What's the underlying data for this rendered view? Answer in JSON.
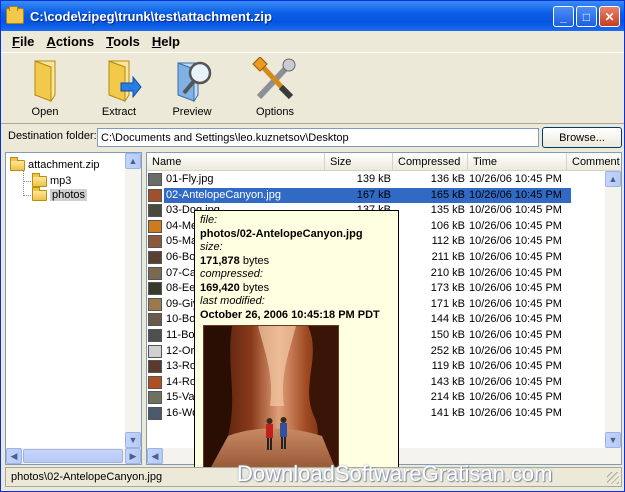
{
  "window": {
    "title": "C:\\code\\zipeg\\trunk\\test\\attachment.zip"
  },
  "menu": [
    "File",
    "Actions",
    "Tools",
    "Help"
  ],
  "toolbar": {
    "open": "Open",
    "extract": "Extract",
    "preview": "Preview",
    "options": "Options"
  },
  "destination": {
    "label": "Destination folder:",
    "value": "C:\\Documents and Settings\\leo.kuznetsov\\Desktop",
    "browse": "Browse..."
  },
  "tree": {
    "root": "attachment.zip",
    "children": [
      "mp3",
      "photos"
    ],
    "selected": "photos"
  },
  "list": {
    "columns": [
      "Name",
      "Size",
      "Compressed",
      "Time",
      "Comment"
    ],
    "rows": [
      {
        "name": "01-Fly.jpg",
        "size": "139 kB",
        "compressed": "136 kB",
        "time": "10/26/06 10:45 PM",
        "icon": "#6b6b6b"
      },
      {
        "name": "02-AntelopeCanyon.jpg",
        "size": "167 kB",
        "compressed": "165 kB",
        "time": "10/26/06 10:45 PM",
        "icon": "#a0502a"
      },
      {
        "name": "03-Dog.jpg",
        "size": "137 kB",
        "compressed": "135 kB",
        "time": "10/26/06 10:45 PM",
        "icon": "#4a4a3a"
      },
      {
        "name": "04-Me",
        "size": "",
        "compressed": "106 kB",
        "time": "10/26/06 10:45 PM",
        "icon": "#d07a20"
      },
      {
        "name": "05-Ma",
        "size": "",
        "compressed": "112 kB",
        "time": "10/26/06 10:45 PM",
        "icon": "#8a5a3a"
      },
      {
        "name": "06-Bo",
        "size": "",
        "compressed": "211 kB",
        "time": "10/26/06 10:45 PM",
        "icon": "#5a4030"
      },
      {
        "name": "07-Ca",
        "size": "",
        "compressed": "210 kB",
        "time": "10/26/06 10:45 PM",
        "icon": "#7a6a50"
      },
      {
        "name": "08-Ee",
        "size": "",
        "compressed": "173 kB",
        "time": "10/26/06 10:45 PM",
        "icon": "#3a3a2a"
      },
      {
        "name": "09-Giy",
        "size": "",
        "compressed": "171 kB",
        "time": "10/26/06 10:45 PM",
        "icon": "#9a7a4a"
      },
      {
        "name": "10-Bo",
        "size": "",
        "compressed": "144 kB",
        "time": "10/26/06 10:45 PM",
        "icon": "#6a5a4a"
      },
      {
        "name": "11-Bo",
        "size": "",
        "compressed": "150 kB",
        "time": "10/26/06 10:45 PM",
        "icon": "#505050"
      },
      {
        "name": "12-Or",
        "size": "",
        "compressed": "252 kB",
        "time": "10/26/06 10:45 PM",
        "icon": "#d0d0d0"
      },
      {
        "name": "13-Ro",
        "size": "",
        "compressed": "119 kB",
        "time": "10/26/06 10:45 PM",
        "icon": "#5a3a2a"
      },
      {
        "name": "14-Ro",
        "size": "",
        "compressed": "143 kB",
        "time": "10/26/06 10:45 PM",
        "icon": "#b05020"
      },
      {
        "name": "15-Va",
        "size": "",
        "compressed": "214 kB",
        "time": "10/26/06 10:45 PM",
        "icon": "#707060"
      },
      {
        "name": "16-Wo",
        "size": "",
        "compressed": "141 kB",
        "time": "10/26/06 10:45 PM",
        "icon": "#4a5a6a"
      }
    ],
    "selected_index": 1
  },
  "tooltip": {
    "file_label": "file:",
    "file_value": "photos/02-AntelopeCanyon.jpg",
    "size_label": "size:",
    "size_value": "171,878",
    "size_unit": " bytes",
    "compressed_label": "compressed:",
    "compressed_value": "169,420",
    "compressed_unit": " bytes",
    "modified_label": "last modified:",
    "modified_value": "October 26, 2006 10:45:18 PM PDT"
  },
  "status": {
    "text": "photos\\02-AntelopeCanyon.jpg"
  },
  "watermark": "DownloadSoftwareGratisan.com",
  "colors": {
    "title_bar": "#0554e0",
    "selection": "#316ac5",
    "tooltip_bg": "#ffffe1"
  }
}
